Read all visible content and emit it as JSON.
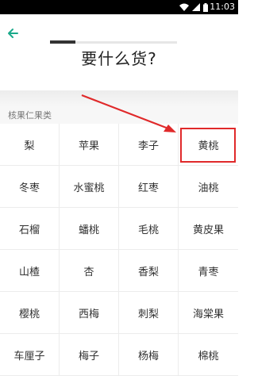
{
  "status_bar": {
    "time": "11:03"
  },
  "header": {
    "title": "要什么货?",
    "progress": 0.2
  },
  "section": {
    "label": "核果仁果类"
  },
  "items": [
    "梨",
    "苹果",
    "李子",
    "黄桃",
    "冬枣",
    "水蜜桃",
    "红枣",
    "油桃",
    "石榴",
    "蟠桃",
    "毛桃",
    "黄皮果",
    "山楂",
    "杏",
    "香梨",
    "青枣",
    "樱桃",
    "西梅",
    "刺梨",
    "海棠果",
    "车厘子",
    "梅子",
    "杨梅",
    "棉桃"
  ],
  "annotation": {
    "highlighted_item": "黄桃",
    "color": "#e0292a"
  },
  "colors": {
    "accent": "#1aa98a",
    "highlight": "#e0292a"
  },
  "icons": [
    "back-arrow-icon",
    "wifi-icon",
    "signal-icon",
    "battery-icon"
  ]
}
